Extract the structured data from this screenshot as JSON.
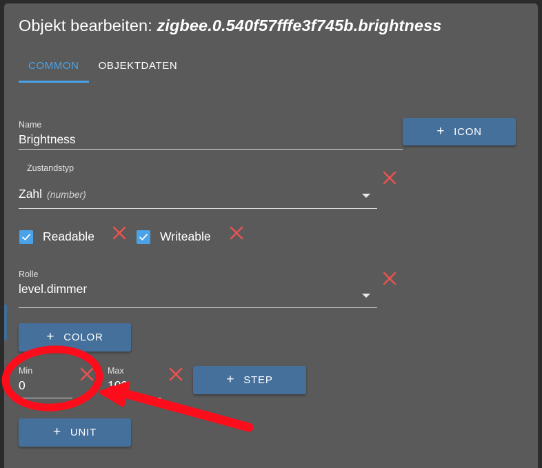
{
  "window": {
    "background_color": "#2b2b2b",
    "panel_color": "#5a5a5a"
  },
  "header": {
    "title_prefix": "Objekt bearbeiten:",
    "object_id": "zigbee.0.540f57fffe3f745b.brightness"
  },
  "tabs": [
    {
      "label": "COMMON",
      "active": true
    },
    {
      "label": "OBJEKTDATEN",
      "active": false
    }
  ],
  "fields": {
    "name": {
      "label": "Name",
      "value": "Brightness",
      "placeholder": "Name"
    },
    "state_type": {
      "label": "Zustandstyp",
      "value": "Zahl",
      "hint": "(number)"
    },
    "readable": {
      "label": "Readable",
      "checked": true
    },
    "writeable": {
      "label": "Writeable",
      "checked": true
    },
    "role": {
      "label": "Rolle",
      "value": "level.dimmer"
    },
    "min": {
      "label": "Min",
      "value": "0",
      "placeholder": "Min"
    },
    "max": {
      "label": "Max",
      "value": "100",
      "placeholder": "Max"
    }
  },
  "buttons": {
    "icon": {
      "label": "ICON",
      "prefix": "+"
    },
    "color": {
      "label": "COLOR",
      "prefix": "+"
    },
    "step": {
      "label": "STEP",
      "prefix": "+"
    },
    "unit": {
      "label": "UNIT",
      "prefix": "+"
    }
  },
  "colors": {
    "accent_blue": "#4aa3e8",
    "button_blue": "#46709c",
    "delete_red": "#e8534f",
    "annotation_red": "#fc0d1b",
    "panel_gray": "#5a5a5a",
    "text_white": "#ffffff"
  },
  "annotation": {
    "shape": "ellipse-and-arrow",
    "target": "Min"
  }
}
